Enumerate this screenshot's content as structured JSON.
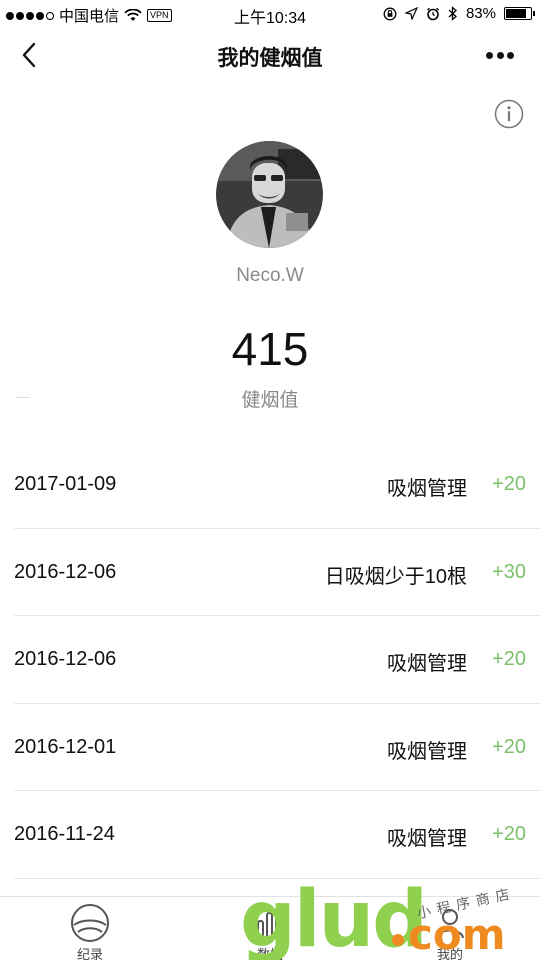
{
  "status_bar": {
    "carrier": "中国电信",
    "vpn": "VPN",
    "time": "上午10:34",
    "battery": "83%",
    "battery_level": 0.83
  },
  "nav": {
    "title": "我的健烟值",
    "back_icon": "chevron-left-icon",
    "more_icon": "more-dots-icon"
  },
  "info_icon": "info-circle-icon",
  "profile": {
    "name": "Neco.W",
    "score": "415",
    "score_label": "健烟值"
  },
  "records": [
    {
      "date": "2017-01-09",
      "desc": "吸烟管理",
      "points": "+20"
    },
    {
      "date": "2016-12-06",
      "desc": "日吸烟少于10根",
      "points": "+30"
    },
    {
      "date": "2016-12-06",
      "desc": "吸烟管理",
      "points": "+20"
    },
    {
      "date": "2016-12-01",
      "desc": "吸烟管理",
      "points": "+20"
    },
    {
      "date": "2016-11-24",
      "desc": "吸烟管理",
      "points": "+20"
    }
  ],
  "tabs": [
    {
      "label": "纪录",
      "icon": "record-icon"
    },
    {
      "label": "数据",
      "icon": "chart-icon"
    },
    {
      "label": "我的",
      "icon": "profile-icon"
    }
  ],
  "watermark": {
    "brand": "glud",
    "domain": "com",
    "slogan": "小程序商店"
  },
  "colors": {
    "accent_green": "#7cc06a",
    "secondary_text": "#8a8a8a"
  }
}
